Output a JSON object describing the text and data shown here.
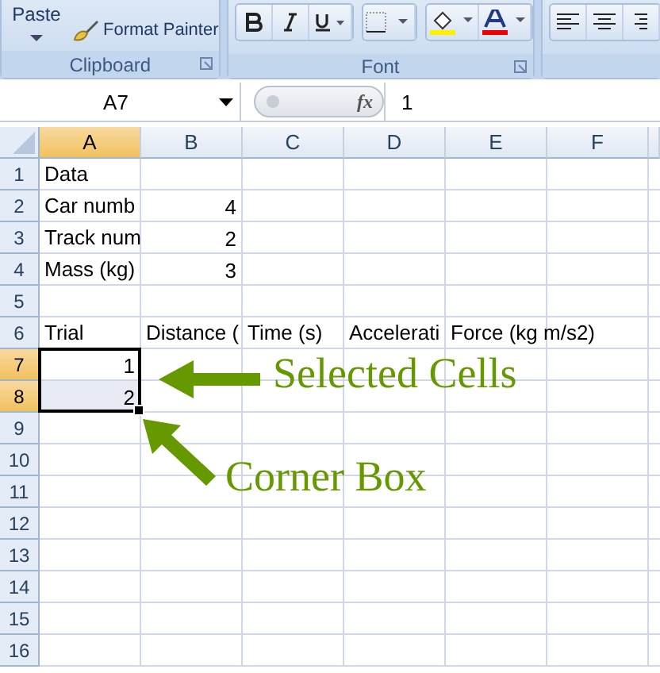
{
  "ribbon": {
    "clipboard": {
      "paste_label": "Paste",
      "format_painter_label": "Format Painter",
      "group_label": "Clipboard"
    },
    "font": {
      "group_label": "Font"
    }
  },
  "formula_bar": {
    "name_box": "A7",
    "fx": "fx",
    "value": "1"
  },
  "sheet": {
    "columns": [
      {
        "label": "A",
        "selected": true
      },
      {
        "label": "B",
        "selected": false
      },
      {
        "label": "C",
        "selected": false
      },
      {
        "label": "D",
        "selected": false
      },
      {
        "label": "E",
        "selected": false
      },
      {
        "label": "F",
        "selected": false
      }
    ],
    "rows": [
      {
        "label": "1",
        "selected": false,
        "cells": [
          {
            "kind": "text",
            "text": "Data"
          },
          {
            "kind": "empty"
          },
          {
            "kind": "empty"
          },
          {
            "kind": "empty"
          },
          {
            "kind": "empty"
          },
          {
            "kind": "empty"
          }
        ]
      },
      {
        "label": "2",
        "selected": false,
        "cells": [
          {
            "kind": "text",
            "text": "Car numb"
          },
          {
            "kind": "number",
            "text": "4"
          },
          {
            "kind": "empty"
          },
          {
            "kind": "empty"
          },
          {
            "kind": "empty"
          },
          {
            "kind": "empty"
          }
        ]
      },
      {
        "label": "3",
        "selected": false,
        "cells": [
          {
            "kind": "text",
            "text": "Track num"
          },
          {
            "kind": "number",
            "text": "2"
          },
          {
            "kind": "empty"
          },
          {
            "kind": "empty"
          },
          {
            "kind": "empty"
          },
          {
            "kind": "empty"
          }
        ]
      },
      {
        "label": "4",
        "selected": false,
        "cells": [
          {
            "kind": "text",
            "text": "Mass (kg)"
          },
          {
            "kind": "number",
            "text": "3"
          },
          {
            "kind": "empty"
          },
          {
            "kind": "empty"
          },
          {
            "kind": "empty"
          },
          {
            "kind": "empty"
          }
        ]
      },
      {
        "label": "5",
        "selected": false,
        "cells": [
          {
            "kind": "empty"
          },
          {
            "kind": "empty"
          },
          {
            "kind": "empty"
          },
          {
            "kind": "empty"
          },
          {
            "kind": "empty"
          },
          {
            "kind": "empty"
          }
        ]
      },
      {
        "label": "6",
        "selected": false,
        "cells": [
          {
            "kind": "text",
            "text": "Trial"
          },
          {
            "kind": "text",
            "text": "Distance ("
          },
          {
            "kind": "text",
            "text": "Time (s)"
          },
          {
            "kind": "text",
            "text": "Accelerati"
          },
          {
            "kind": "text",
            "text": "Force (kg m/s2)"
          },
          {
            "kind": "empty"
          }
        ]
      },
      {
        "label": "7",
        "selected": true,
        "cells": [
          {
            "kind": "number",
            "text": "1"
          },
          {
            "kind": "empty"
          },
          {
            "kind": "empty"
          },
          {
            "kind": "empty"
          },
          {
            "kind": "empty"
          },
          {
            "kind": "empty"
          }
        ]
      },
      {
        "label": "8",
        "selected": true,
        "cells": [
          {
            "kind": "number",
            "text": "2"
          },
          {
            "kind": "empty"
          },
          {
            "kind": "empty"
          },
          {
            "kind": "empty"
          },
          {
            "kind": "empty"
          },
          {
            "kind": "empty"
          }
        ]
      },
      {
        "label": "9",
        "selected": false,
        "cells": [
          {
            "kind": "empty"
          },
          {
            "kind": "empty"
          },
          {
            "kind": "empty"
          },
          {
            "kind": "empty"
          },
          {
            "kind": "empty"
          },
          {
            "kind": "empty"
          }
        ]
      },
      {
        "label": "10",
        "selected": false,
        "cells": [
          {
            "kind": "empty"
          },
          {
            "kind": "empty"
          },
          {
            "kind": "empty"
          },
          {
            "kind": "empty"
          },
          {
            "kind": "empty"
          },
          {
            "kind": "empty"
          }
        ]
      },
      {
        "label": "11",
        "selected": false,
        "cells": [
          {
            "kind": "empty"
          },
          {
            "kind": "empty"
          },
          {
            "kind": "empty"
          },
          {
            "kind": "empty"
          },
          {
            "kind": "empty"
          },
          {
            "kind": "empty"
          }
        ]
      },
      {
        "label": "12",
        "selected": false,
        "cells": [
          {
            "kind": "empty"
          },
          {
            "kind": "empty"
          },
          {
            "kind": "empty"
          },
          {
            "kind": "empty"
          },
          {
            "kind": "empty"
          },
          {
            "kind": "empty"
          }
        ]
      },
      {
        "label": "13",
        "selected": false,
        "cells": [
          {
            "kind": "empty"
          },
          {
            "kind": "empty"
          },
          {
            "kind": "empty"
          },
          {
            "kind": "empty"
          },
          {
            "kind": "empty"
          },
          {
            "kind": "empty"
          }
        ]
      },
      {
        "label": "14",
        "selected": false,
        "cells": [
          {
            "kind": "empty"
          },
          {
            "kind": "empty"
          },
          {
            "kind": "empty"
          },
          {
            "kind": "empty"
          },
          {
            "kind": "empty"
          },
          {
            "kind": "empty"
          }
        ]
      },
      {
        "label": "15",
        "selected": false,
        "cells": [
          {
            "kind": "empty"
          },
          {
            "kind": "empty"
          },
          {
            "kind": "empty"
          },
          {
            "kind": "empty"
          },
          {
            "kind": "empty"
          },
          {
            "kind": "empty"
          }
        ]
      },
      {
        "label": "16",
        "selected": false,
        "cells": [
          {
            "kind": "empty"
          },
          {
            "kind": "empty"
          },
          {
            "kind": "empty"
          },
          {
            "kind": "empty"
          },
          {
            "kind": "empty"
          },
          {
            "kind": "empty"
          }
        ]
      }
    ]
  },
  "annotations": [
    {
      "kind": "left",
      "text": "Selected Cells"
    },
    {
      "kind": "diagonal",
      "text": "Corner Box"
    }
  ]
}
